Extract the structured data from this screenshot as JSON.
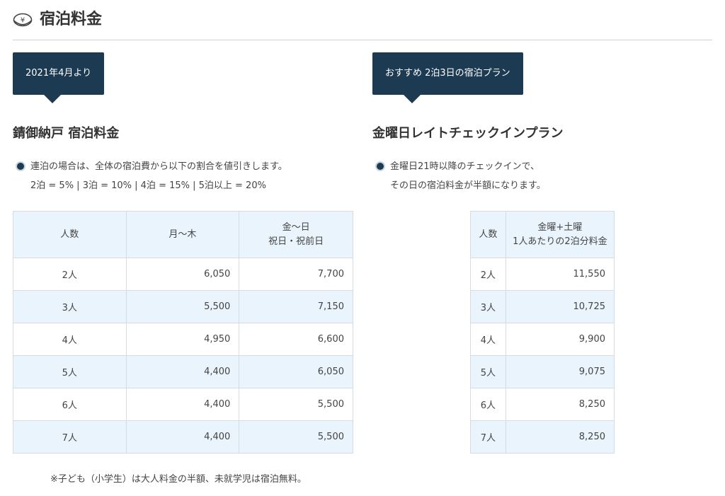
{
  "header": {
    "title": "宿泊料金",
    "icon": "yen-coin-icon"
  },
  "left": {
    "tag": "2021年4月より",
    "title": "錆御納戸 宿泊料金",
    "note_lines": [
      "連泊の場合は、全体の宿泊費から以下の割合を値引きします。",
      "2泊 = 5% | 3泊 = 10% | 4泊 = 15% | 5泊以上 = 20%"
    ],
    "table": {
      "headers": [
        "人数",
        "月〜木",
        "金〜日",
        "祝日・祝前日"
      ],
      "rows": [
        [
          "2人",
          "6,050",
          "7,700"
        ],
        [
          "3人",
          "5,500",
          "7,150"
        ],
        [
          "4人",
          "4,950",
          "6,600"
        ],
        [
          "5人",
          "4,400",
          "6,050"
        ],
        [
          "6人",
          "4,400",
          "5,500"
        ],
        [
          "7人",
          "4,400",
          "5,500"
        ]
      ]
    }
  },
  "right": {
    "tag": "おすすめ 2泊3日の宿泊プラン",
    "title": "金曜日レイトチェックインプラン",
    "note_lines": [
      "金曜日21時以降のチェックインで、",
      "その日の宿泊料金が半額になります。"
    ],
    "table": {
      "headers": [
        "人数",
        "金曜+土曜",
        "1人あたりの2泊分料金"
      ],
      "rows": [
        [
          "2人",
          "11,550"
        ],
        [
          "3人",
          "10,725"
        ],
        [
          "4人",
          "9,900"
        ],
        [
          "5人",
          "9,075"
        ],
        [
          "6人",
          "8,250"
        ],
        [
          "7人",
          "8,250"
        ]
      ]
    }
  },
  "footnote": "※子ども（小学生）は大人料金の半額、未就学児は宿泊無料。",
  "colors": {
    "accent": "#1c3b52",
    "row_alt": "#eaf4fc",
    "border": "#d6dde2"
  }
}
